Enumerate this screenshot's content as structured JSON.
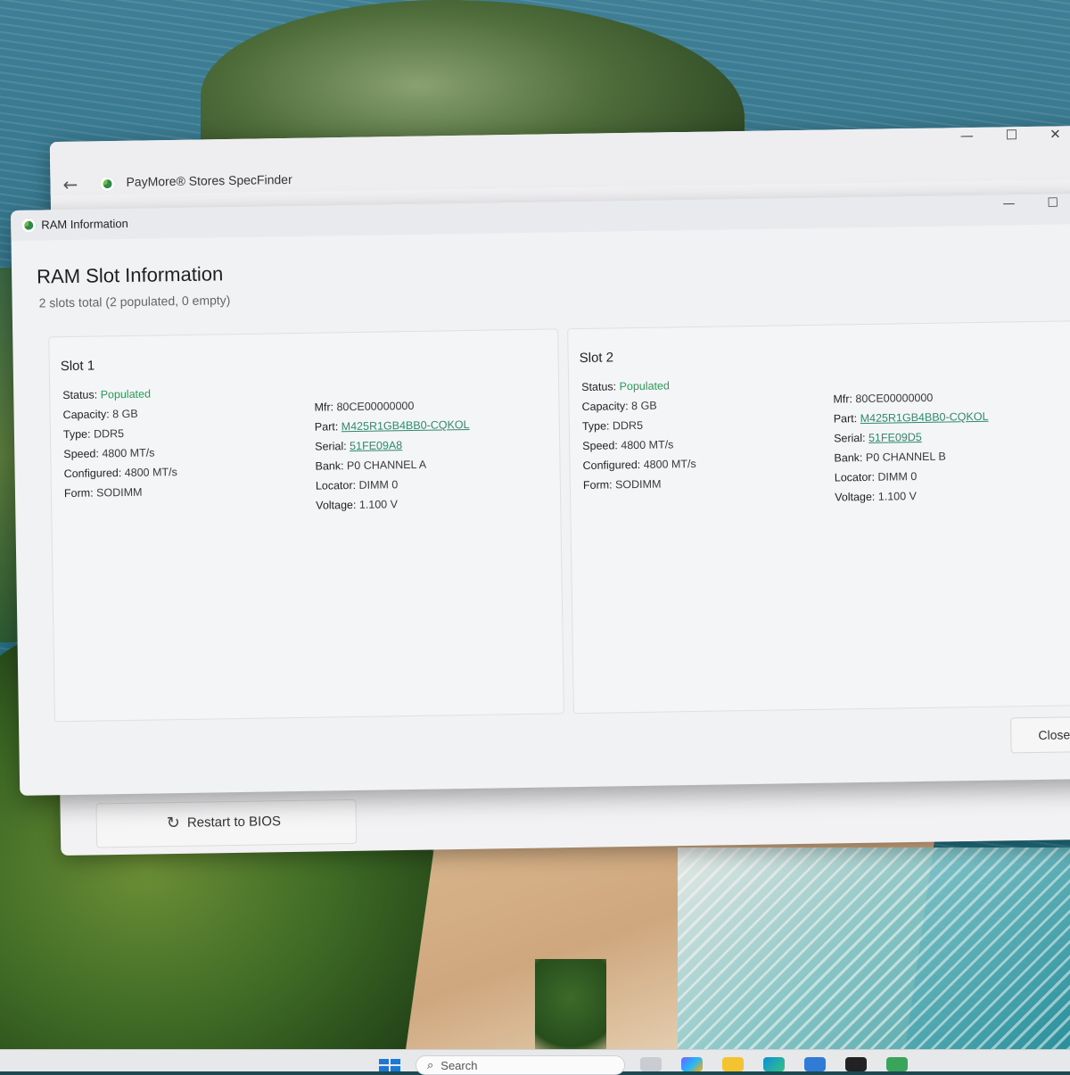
{
  "main_window": {
    "title": "PayMore® Stores SpecFinder",
    "back_glyph": "←",
    "min_glyph": "—",
    "max_glyph": "☐",
    "close_glyph": "✕",
    "restart_label": "Restart to BIOS",
    "restart_glyph": "↻"
  },
  "dialog": {
    "title": "RAM Information",
    "min_glyph": "—",
    "max_glyph": "☐",
    "heading": "RAM Slot Information",
    "summary": "2 slots total (2 populated, 0 empty)",
    "close_label": "Close"
  },
  "slots": [
    {
      "title": "Slot 1",
      "left": [
        {
          "label": "Status:",
          "value": "Populated"
        },
        {
          "label": "Capacity:",
          "value": "8 GB"
        },
        {
          "label": "Type:",
          "value": "DDR5"
        },
        {
          "label": "Speed:",
          "value": "4800 MT/s"
        },
        {
          "label": "Configured:",
          "value": "4800 MT/s"
        },
        {
          "label": "Form:",
          "value": "SODIMM"
        }
      ],
      "right": [
        {
          "label": "Mfr:",
          "value": "80CE00000000"
        },
        {
          "label": "Part:",
          "value": "M425R1GB4BB0-CQKOL"
        },
        {
          "label": "Serial:",
          "value": "51FE09A8"
        },
        {
          "label": "Bank:",
          "value": "P0 CHANNEL A"
        },
        {
          "label": "Locator:",
          "value": "DIMM 0"
        },
        {
          "label": "Voltage:",
          "value": "1.100 V"
        }
      ]
    },
    {
      "title": "Slot 2",
      "left": [
        {
          "label": "Status:",
          "value": "Populated"
        },
        {
          "label": "Capacity:",
          "value": "8 GB"
        },
        {
          "label": "Type:",
          "value": "DDR5"
        },
        {
          "label": "Speed:",
          "value": "4800 MT/s"
        },
        {
          "label": "Configured:",
          "value": "4800 MT/s"
        },
        {
          "label": "Form:",
          "value": "SODIMM"
        }
      ],
      "right": [
        {
          "label": "Mfr:",
          "value": "80CE00000000"
        },
        {
          "label": "Part:",
          "value": "M425R1GB4BB0-CQKOL"
        },
        {
          "label": "Serial:",
          "value": "51FE09D5"
        },
        {
          "label": "Bank:",
          "value": "P0 CHANNEL B"
        },
        {
          "label": "Locator:",
          "value": "DIMM 0"
        },
        {
          "label": "Voltage:",
          "value": "1.100 V"
        }
      ]
    }
  ],
  "taskbar": {
    "search_placeholder": "Search",
    "search_glyph": "⌕",
    "pinned_icons": [
      "start-icon",
      "search-icon",
      "task-view-icon",
      "copilot-icon",
      "file-explorer-icon",
      "edge-icon",
      "store-icon",
      "chrome-icon",
      "specfinder-icon"
    ]
  },
  "colors": {
    "status_green": "#2c9a5a",
    "link_green": "#2e8b6a",
    "accent_blue": "#1b78d4"
  }
}
